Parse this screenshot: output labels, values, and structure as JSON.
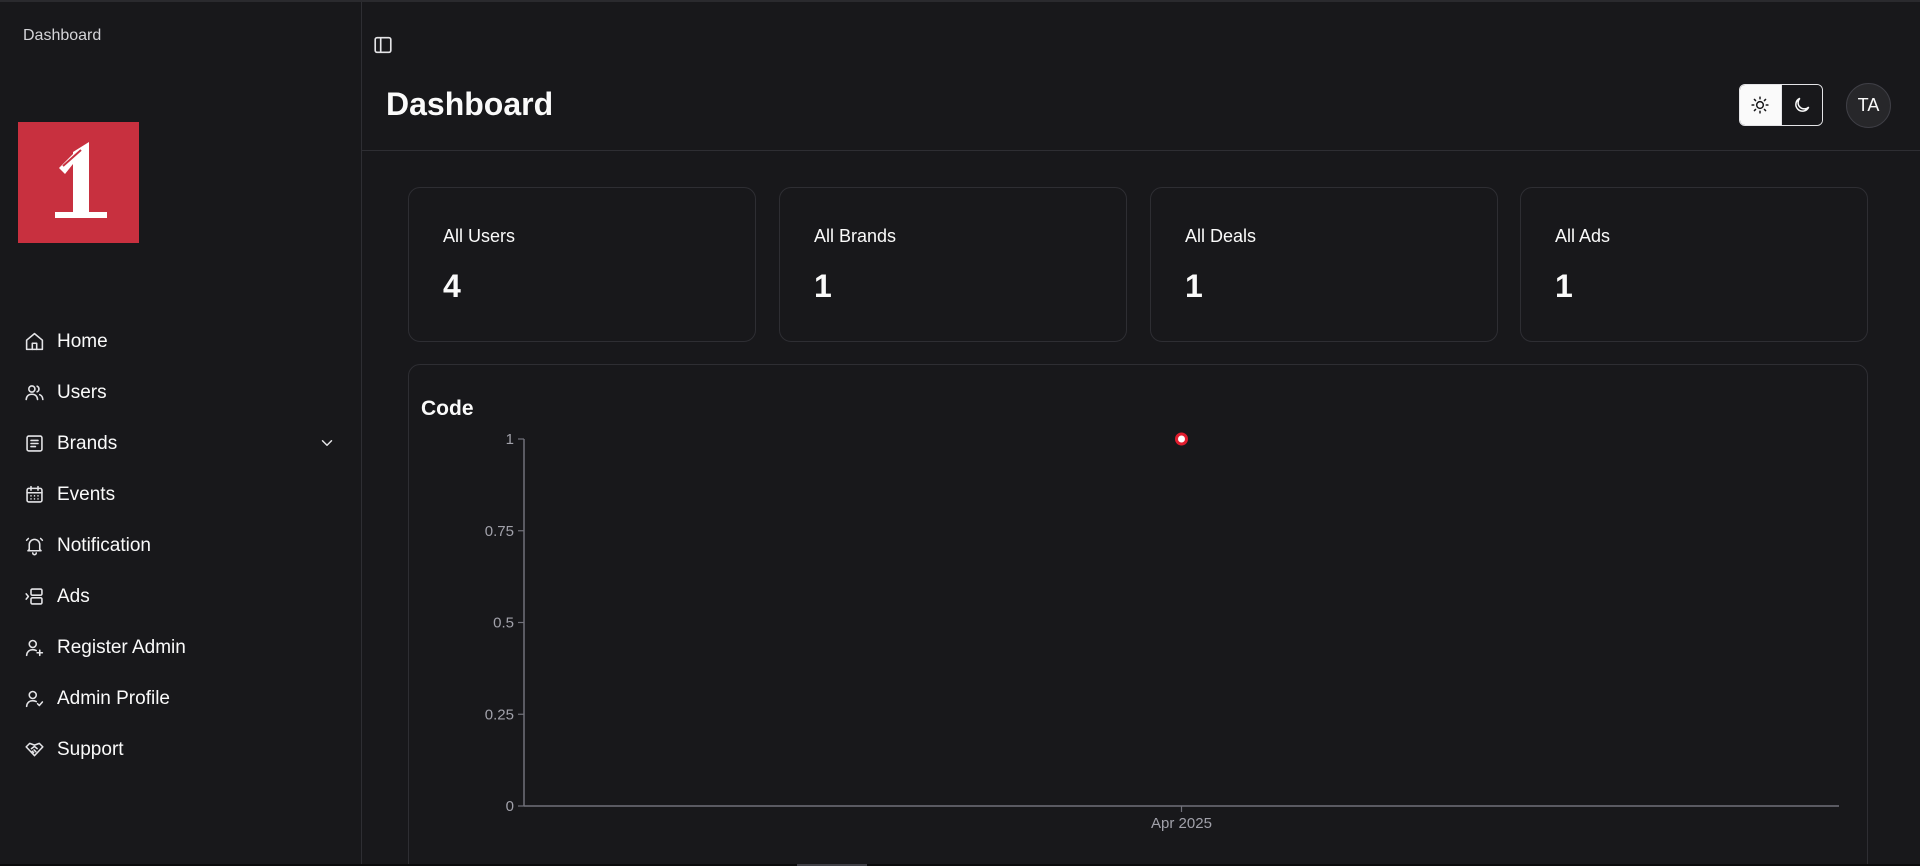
{
  "breadcrumb": "Dashboard",
  "colors": {
    "brand": "#c8303f",
    "background": "#18181b",
    "point": "#e11d2e"
  },
  "sidebar": {
    "items": [
      {
        "label": "Home",
        "icon": "home-icon"
      },
      {
        "label": "Users",
        "icon": "users-icon"
      },
      {
        "label": "Brands",
        "icon": "brands-icon",
        "expandable": true
      },
      {
        "label": "Events",
        "icon": "calendar-icon"
      },
      {
        "label": "Notification",
        "icon": "bell-icon"
      },
      {
        "label": "Ads",
        "icon": "ads-icon"
      },
      {
        "label": "Register Admin",
        "icon": "user-plus-icon"
      },
      {
        "label": "Admin Profile",
        "icon": "user-check-icon"
      },
      {
        "label": "Support",
        "icon": "handshake-icon"
      }
    ]
  },
  "header": {
    "title": "Dashboard",
    "theme": "light",
    "avatar_initials": "TA"
  },
  "stats": [
    {
      "label": "All Users",
      "value": "4"
    },
    {
      "label": "All Brands",
      "value": "1"
    },
    {
      "label": "All Deals",
      "value": "1"
    },
    {
      "label": "All Ads",
      "value": "1"
    }
  ],
  "chart_data": {
    "type": "line",
    "title": "Code",
    "x": [
      "Apr 2025"
    ],
    "series": [
      {
        "values": [
          1
        ]
      }
    ],
    "y_ticks": [
      "0",
      "0.25",
      "0.5",
      "0.75",
      "1"
    ],
    "x_ticks": [
      "Apr 2025"
    ],
    "ylim": [
      0,
      1
    ],
    "grid": false
  }
}
